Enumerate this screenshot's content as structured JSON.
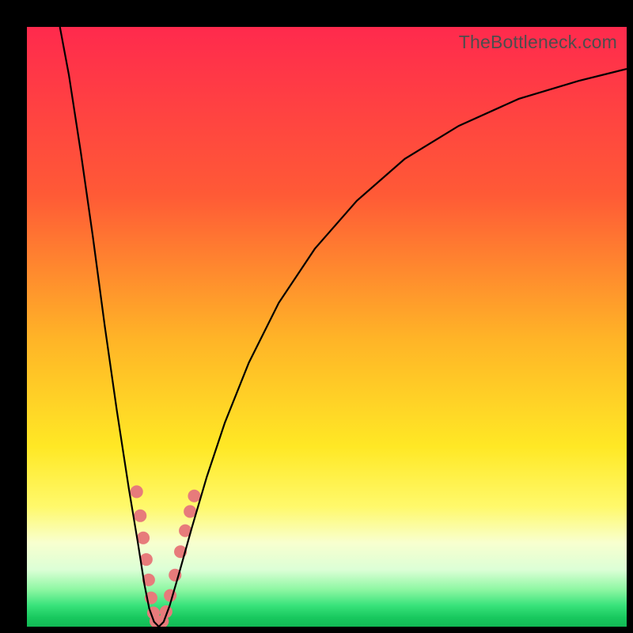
{
  "watermark": "TheBottleneck.com",
  "chart_data": {
    "type": "line",
    "title": "",
    "xlabel": "",
    "ylabel": "",
    "xlim": [
      0,
      100
    ],
    "ylim": [
      0,
      100
    ],
    "grid": false,
    "legend": false,
    "background_gradient": {
      "stops": [
        {
          "pos": 0.0,
          "color": "#ff2a4d"
        },
        {
          "pos": 0.28,
          "color": "#ff5a36"
        },
        {
          "pos": 0.52,
          "color": "#ffb427"
        },
        {
          "pos": 0.7,
          "color": "#ffe825"
        },
        {
          "pos": 0.8,
          "color": "#fff96b"
        },
        {
          "pos": 0.86,
          "color": "#f8ffcf"
        },
        {
          "pos": 0.905,
          "color": "#dcffd6"
        },
        {
          "pos": 0.938,
          "color": "#8ef7a3"
        },
        {
          "pos": 0.965,
          "color": "#38e27a"
        },
        {
          "pos": 0.985,
          "color": "#18c85e"
        },
        {
          "pos": 1.0,
          "color": "#12b955"
        }
      ]
    },
    "series": [
      {
        "name": "bottleneck-curve-left",
        "stroke": "#000000",
        "points": [
          {
            "x": 5.5,
            "y": 100.0
          },
          {
            "x": 7.0,
            "y": 92.0
          },
          {
            "x": 9.0,
            "y": 79.0
          },
          {
            "x": 11.0,
            "y": 65.0
          },
          {
            "x": 13.0,
            "y": 50.0
          },
          {
            "x": 15.0,
            "y": 36.0
          },
          {
            "x": 17.0,
            "y": 23.0
          },
          {
            "x": 18.5,
            "y": 14.0
          },
          {
            "x": 19.6,
            "y": 7.0
          },
          {
            "x": 20.4,
            "y": 3.0
          },
          {
            "x": 21.2,
            "y": 0.8
          },
          {
            "x": 22.0,
            "y": 0.0
          }
        ]
      },
      {
        "name": "bottleneck-curve-right",
        "stroke": "#000000",
        "points": [
          {
            "x": 22.0,
            "y": 0.0
          },
          {
            "x": 22.8,
            "y": 0.8
          },
          {
            "x": 23.8,
            "y": 3.5
          },
          {
            "x": 25.4,
            "y": 9.0
          },
          {
            "x": 27.5,
            "y": 16.5
          },
          {
            "x": 30.0,
            "y": 25.0
          },
          {
            "x": 33.0,
            "y": 34.0
          },
          {
            "x": 37.0,
            "y": 44.0
          },
          {
            "x": 42.0,
            "y": 54.0
          },
          {
            "x": 48.0,
            "y": 63.0
          },
          {
            "x": 55.0,
            "y": 71.0
          },
          {
            "x": 63.0,
            "y": 78.0
          },
          {
            "x": 72.0,
            "y": 83.5
          },
          {
            "x": 82.0,
            "y": 88.0
          },
          {
            "x": 92.0,
            "y": 91.0
          },
          {
            "x": 100.0,
            "y": 93.0
          }
        ]
      }
    ],
    "markers": {
      "name": "highlight-points",
      "color": "#e77b7b",
      "radius_px": 8,
      "points": [
        {
          "x": 18.3,
          "y": 22.5
        },
        {
          "x": 18.9,
          "y": 18.5
        },
        {
          "x": 19.4,
          "y": 14.8
        },
        {
          "x": 19.9,
          "y": 11.2
        },
        {
          "x": 20.3,
          "y": 7.8
        },
        {
          "x": 20.7,
          "y": 4.8
        },
        {
          "x": 21.1,
          "y": 2.3
        },
        {
          "x": 21.5,
          "y": 0.9
        },
        {
          "x": 22.0,
          "y": 0.3
        },
        {
          "x": 22.6,
          "y": 0.9
        },
        {
          "x": 23.2,
          "y": 2.5
        },
        {
          "x": 23.9,
          "y": 5.2
        },
        {
          "x": 24.7,
          "y": 8.6
        },
        {
          "x": 25.6,
          "y": 12.5
        },
        {
          "x": 26.4,
          "y": 16.0
        },
        {
          "x": 27.2,
          "y": 19.2
        },
        {
          "x": 27.9,
          "y": 21.8
        }
      ]
    }
  }
}
